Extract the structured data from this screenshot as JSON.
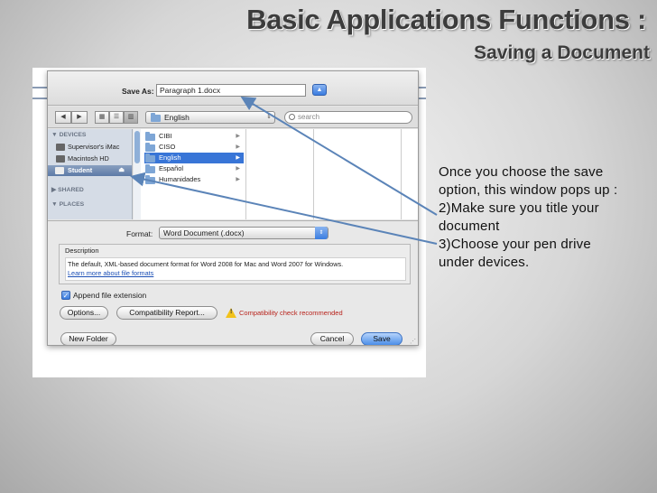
{
  "slide": {
    "title": "Basic Applications Functions :",
    "subtitle": "Saving a Document",
    "callout_lines": [
      "Once you choose the save",
      "option, this window pops up :",
      "2)Make sure you title your",
      "document",
      "3)Choose your pen drive",
      "under devices."
    ]
  },
  "dialog": {
    "save_as_label": "Save As:",
    "save_as_value": "Paragraph 1.docx",
    "expand_glyph": "▲",
    "location": "English",
    "search_placeholder": "search",
    "toolbar_glyphs": {
      "back": "◀",
      "forward": "▶",
      "icon_view": "▦",
      "list_view": "☰",
      "column_view": "▥",
      "popup_arrows": "⇕"
    },
    "sidebar": {
      "devices_header": "▼ DEVICES",
      "devices": [
        "Supervisor's iMac",
        "Macintosh HD",
        "Student"
      ],
      "selected_device": "Student",
      "eject_glyph": "⏏",
      "shared_header": "▶ SHARED",
      "places_header": "▼ PLACES"
    },
    "folders": [
      "CIBI",
      "CISO",
      "English",
      "Español",
      "Humanidades"
    ],
    "selected_folder": "English",
    "folder_arrow": "▶",
    "format_label": "Format:",
    "format_value": "Word Document (.docx)",
    "format_arrows": "⇕",
    "description_title": "Description",
    "description_text": "The default, XML-based document format for Word 2008 for Mac and Word 2007 for Windows.",
    "description_link": "Learn more about file formats",
    "append_extension_label": "Append file extension",
    "append_extension_checked": true,
    "check_glyph": "✓",
    "options_button": "Options...",
    "compat_button": "Compatibility Report...",
    "compat_warning": "Compatibility check recommended",
    "new_folder_button": "New Folder",
    "cancel_button": "Cancel",
    "save_button": "Save",
    "resize_glyph": "⋰"
  },
  "colors": {
    "accent": "#3875d7",
    "arrow": "#5b84b8",
    "warning": "#f2c21b",
    "warning_text": "#b8231c"
  }
}
